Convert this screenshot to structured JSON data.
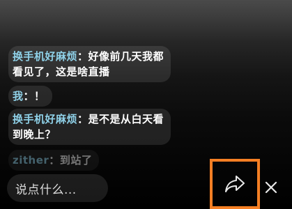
{
  "chat": {
    "messages": [
      {
        "user": "换手机好麻烦",
        "sep": "：",
        "line1": "好像前几天我都",
        "line2": "看见了，这是啥直播"
      },
      {
        "user": "我",
        "sep": "：",
        "line1": "！"
      },
      {
        "user": "换手机好麻烦",
        "sep": "：",
        "line1": "是不是从白天看",
        "line2": "到晚上？"
      },
      {
        "user": "zither",
        "sep": "：",
        "line1": "到站了"
      }
    ]
  },
  "bottom_bar": {
    "input_placeholder": "说点什么...",
    "share_icon": "share-arrow-icon",
    "close_icon": "close-icon",
    "highlight_color": "#f47f24"
  }
}
